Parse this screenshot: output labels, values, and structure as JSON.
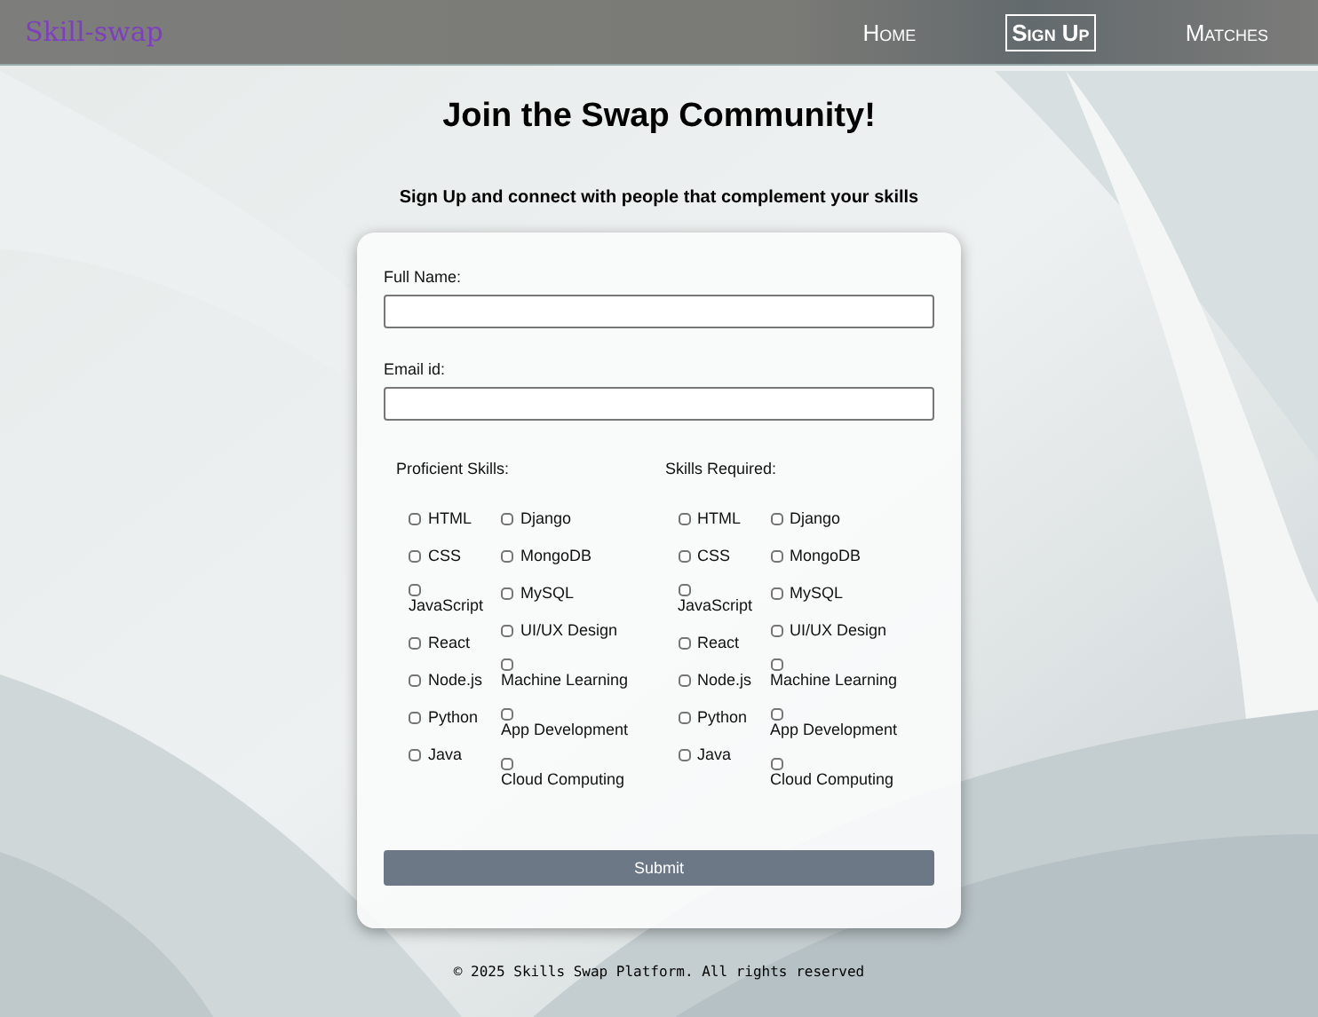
{
  "nav": {
    "logo": "Skill-swap",
    "links": [
      {
        "label": "Home",
        "selected": false
      },
      {
        "label": "Sign Up",
        "selected": true
      },
      {
        "label": "Matches",
        "selected": false
      }
    ]
  },
  "title": "Join the Swap Community!",
  "subtitle": "Sign Up and connect with people that complement your skills",
  "form": {
    "fields": [
      {
        "label": "Full Name:"
      },
      {
        "label": "Email id:"
      }
    ],
    "skill_groups": [
      {
        "label": "Proficient Skills:",
        "columns": [
          [
            {
              "label": "HTML",
              "checked": false
            },
            {
              "label": "CSS",
              "checked": false
            },
            {
              "label": "JavaScript",
              "checked": false
            },
            {
              "label": "React",
              "checked": false
            },
            {
              "label": "Node.js",
              "checked": false
            },
            {
              "label": "Python",
              "checked": false
            },
            {
              "label": "Java",
              "checked": false
            }
          ],
          [
            {
              "label": "Django",
              "checked": false
            },
            {
              "label": "MongoDB",
              "checked": false
            },
            {
              "label": "MySQL",
              "checked": false
            },
            {
              "label": "UI/UX Design",
              "checked": false
            },
            {
              "label": "Machine Learning",
              "checked": false
            },
            {
              "label": "App Development",
              "checked": false
            },
            {
              "label": "Cloud Computing",
              "checked": false
            }
          ]
        ]
      },
      {
        "label": "Skills Required:",
        "columns": [
          [
            {
              "label": "HTML",
              "checked": false
            },
            {
              "label": "CSS",
              "checked": false
            },
            {
              "label": "JavaScript",
              "checked": false
            },
            {
              "label": "React",
              "checked": false
            },
            {
              "label": "Node.js",
              "checked": false
            },
            {
              "label": "Python",
              "checked": false
            },
            {
              "label": "Java",
              "checked": false
            }
          ],
          [
            {
              "label": "Django",
              "checked": false
            },
            {
              "label": "MongoDB",
              "checked": false
            },
            {
              "label": "MySQL",
              "checked": false
            },
            {
              "label": "UI/UX Design",
              "checked": false
            },
            {
              "label": "Machine Learning",
              "checked": false
            },
            {
              "label": "App Development",
              "checked": false
            },
            {
              "label": "Cloud Computing",
              "checked": false
            }
          ]
        ]
      }
    ],
    "submit": "Submit"
  },
  "footer": "© 2025 Skills Swap Platform. All rights reserved"
}
